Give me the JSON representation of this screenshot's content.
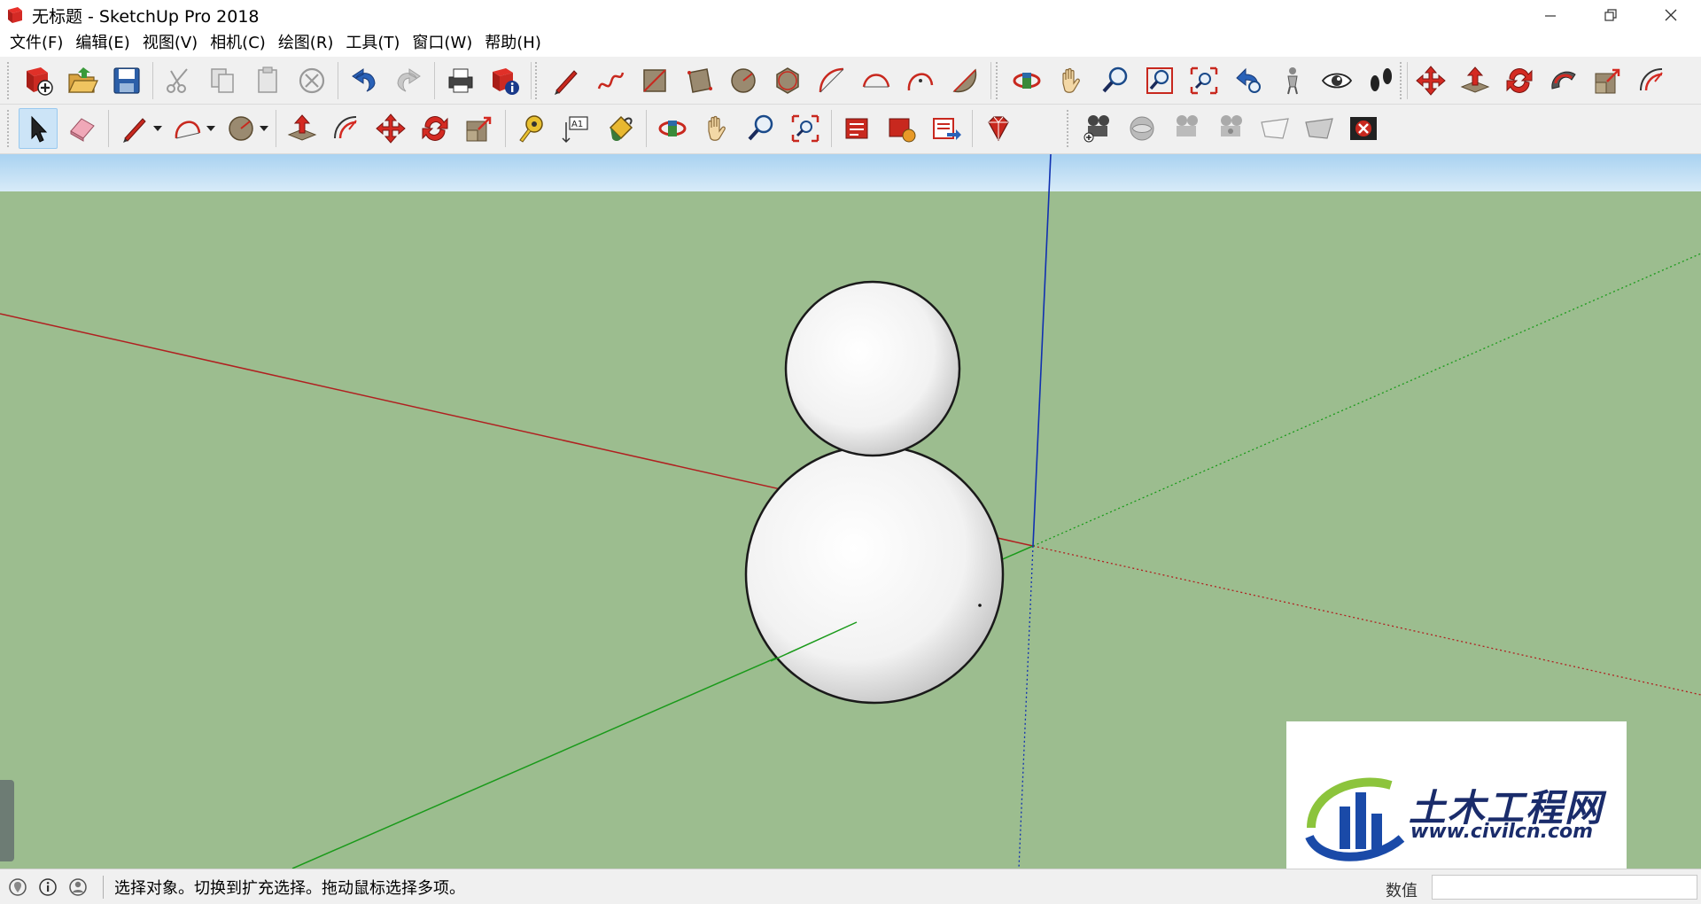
{
  "window": {
    "title": "无标题 - SketchUp Pro 2018"
  },
  "menu": [
    {
      "label": "文件(F)"
    },
    {
      "label": "编辑(E)"
    },
    {
      "label": "视图(V)"
    },
    {
      "label": "相机(C)"
    },
    {
      "label": "绘图(R)"
    },
    {
      "label": "工具(T)"
    },
    {
      "label": "窗口(W)"
    },
    {
      "label": "帮助(H)"
    }
  ],
  "toolbar1": {
    "icons": [
      "new-file-icon",
      "open-folder-icon",
      "save-icon",
      "cut-icon",
      "copy-icon",
      "paste-icon",
      "delete-icon",
      "undo-icon",
      "redo-icon",
      "print-icon",
      "model-info-icon",
      "pencil-line-icon",
      "freehand-icon",
      "rectangle-icon",
      "rotated-rectangle-icon",
      "circle-icon",
      "polygon-icon",
      "arc-icon",
      "two-point-arc-icon",
      "three-point-arc-icon",
      "pie-icon",
      "orbit-icon",
      "pan-icon",
      "zoom-icon",
      "zoom-window-icon",
      "zoom-extents-icon",
      "previous-view-icon",
      "position-camera-icon",
      "look-around-icon",
      "walk-icon",
      "move-icon",
      "push-pull-icon",
      "rotate-icon",
      "follow-me-icon",
      "scale-icon",
      "offset-icon"
    ]
  },
  "toolbar2": {
    "icons": [
      "select-icon",
      "eraser-icon",
      "pencil-icon",
      "arc-dropdown-icon",
      "circle-dropdown-icon",
      "push-pull-icon",
      "follow-me-icon",
      "move-icon",
      "rotate-icon",
      "scale-icon",
      "tape-measure-icon",
      "text-icon",
      "paint-bucket-icon",
      "orbit-icon",
      "pan-icon",
      "zoom-icon",
      "zoom-extents-icon",
      "3d-warehouse-icon",
      "extension-warehouse-icon",
      "layout-send-icon",
      "ruby-console-icon",
      "add-camera-icon",
      "camera-look-icon",
      "camera-frustum-icon",
      "camera-properties-icon",
      "camera-mask-icon",
      "camera-plane-icon",
      "camera-clear-icon"
    ]
  },
  "colors": {
    "sky": "#c4def5",
    "ground": "#9cbd8f",
    "axis_red": "#b02020",
    "axis_green": "#1a9a1a",
    "axis_blue": "#1030b0",
    "watermark_blue": "#1a2c6b"
  },
  "status": {
    "hint": "选择对象。切换到扩充选择。拖动鼠标选择多项。",
    "measure_label": "数值",
    "measure_value": ""
  },
  "watermark": {
    "title": "土木工程网",
    "url": "www.civilcn.com"
  }
}
